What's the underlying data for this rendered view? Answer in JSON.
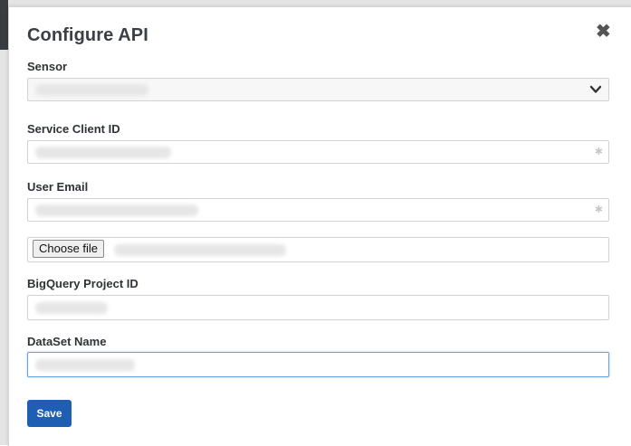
{
  "dialog": {
    "title": "Configure API",
    "close_icon": "close-icon"
  },
  "fields": {
    "sensor": {
      "label": "Sensor",
      "icon": "chevron-down-icon"
    },
    "service_client_id": {
      "label": "Service Client ID"
    },
    "user_email": {
      "label": "User Email"
    },
    "file": {
      "button_label": "Choose file"
    },
    "bigquery_project_id": {
      "label": "BigQuery Project ID"
    },
    "dataset_name": {
      "label": "DataSet Name"
    }
  },
  "actions": {
    "save_label": "Save"
  },
  "colors": {
    "primary": "#1f5fb3",
    "title": "#3b4047",
    "focus": "#66a3e0"
  }
}
